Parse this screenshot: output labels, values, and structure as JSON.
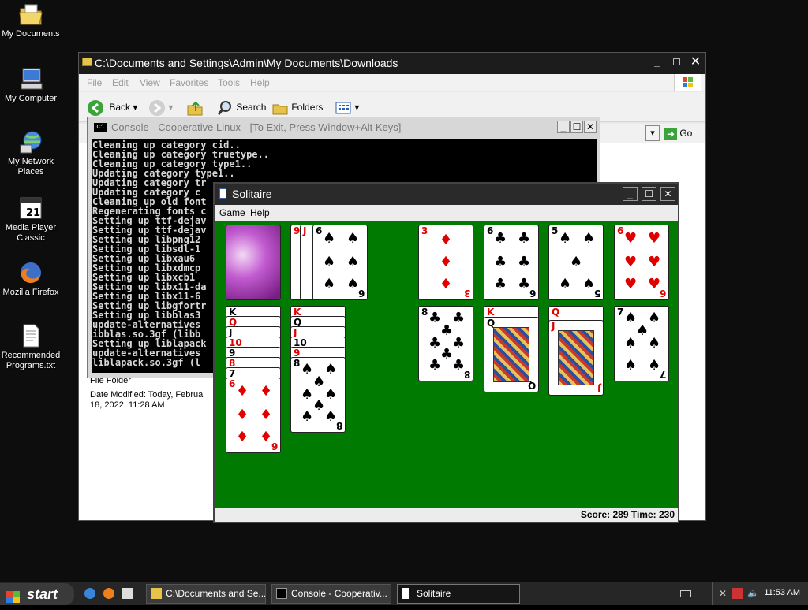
{
  "desktop": {
    "icons": [
      {
        "label": "My Documents"
      },
      {
        "label": "My Computer"
      },
      {
        "label": "My Network Places"
      },
      {
        "label": "Media Player Classic"
      },
      {
        "label": "Mozilla Firefox"
      },
      {
        "label": "Recommended Programs.txt"
      }
    ]
  },
  "explorer": {
    "title": "C:\\Documents and Settings\\Admin\\My Documents\\Downloads",
    "menu": [
      "File",
      "Edit",
      "View",
      "Favorites",
      "Tools",
      "Help"
    ],
    "toolbar": {
      "back": "Back",
      "search": "Search",
      "folders": "Folders"
    },
    "address": {
      "go": "Go"
    },
    "details": {
      "type": "File Folder",
      "modified": "Date Modified: Today, Februa",
      "modified2": "18, 2022, 11:28 AM"
    }
  },
  "console": {
    "title": "Console - Cooperative Linux - [To Exit, Press Window+Alt Keys]",
    "lines": [
      "Cleaning up category cid..",
      "Cleaning up category truetype..",
      "Cleaning up category type1..",
      "Updating category type1..",
      "Updating category tr",
      "Updating category c",
      "Cleaning up old font",
      "Regenerating fonts c",
      "Setting up ttf-dejav",
      "Setting up ttf-dejav",
      "Setting up libpng12",
      "Setting up libsdl-1",
      "Setting up libxau6",
      "Setting up libxdmcp",
      "Setting up libxcb1",
      "Setting up libx11-da",
      "Setting up libx11-6",
      "Setting up libgfortr",
      "Setting up libblas3",
      "update-alternatives",
      "ibblas.so.3gf (libb",
      "Setting up liblapack",
      "update-alternatives",
      "liblapack.so.3gf (l"
    ]
  },
  "solitaire": {
    "title": "Solitaire",
    "menu": [
      "Game",
      "Help"
    ],
    "status": "Score: 289 Time: 230",
    "cards": {
      "waste": [
        "9",
        "J",
        "6"
      ],
      "foundation": [
        "3",
        "6",
        "5",
        "6"
      ],
      "col1": [
        "K",
        "Q",
        "J",
        "10",
        "9",
        "8",
        "7",
        "6"
      ],
      "col2": [
        "K",
        "Q",
        "J",
        "10",
        "9",
        "8"
      ],
      "tab": [
        "8",
        "Q",
        "J",
        "7"
      ],
      "tab_top": [
        "K",
        "Q"
      ],
      "suits": {
        "heart": "♥",
        "diamond": "♦",
        "spade": "♠",
        "club": "♣"
      }
    }
  },
  "taskbar": {
    "start": "start",
    "tasks": [
      "C:\\Documents and Se...",
      "Console - Cooperativ...",
      "Solitaire"
    ],
    "clock": "11:53 AM"
  },
  "colors": {
    "felt": "#007a00",
    "red": "#e00000"
  }
}
